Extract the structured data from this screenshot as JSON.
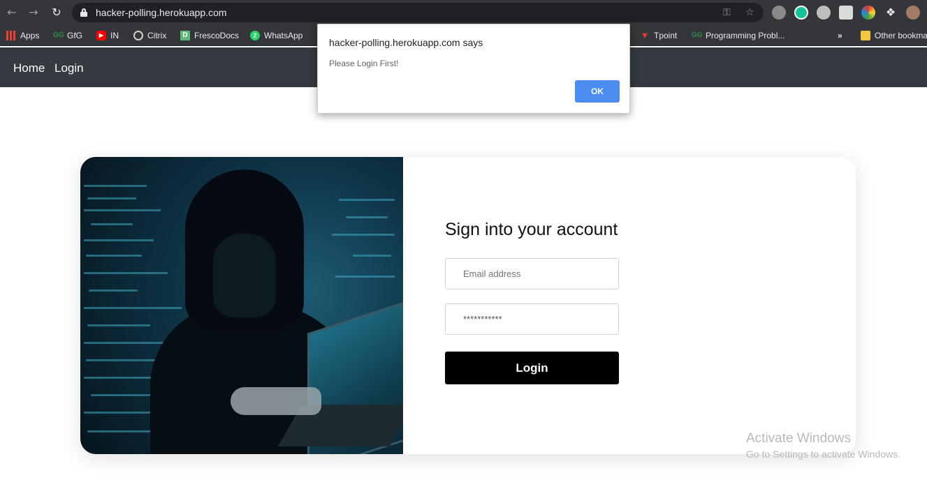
{
  "browser": {
    "url": "hacker-polling.herokuapp.com",
    "bookmarks": [
      {
        "label": "Apps",
        "icon": "apps-grid-icon"
      },
      {
        "label": "GfG",
        "icon": "gfg-icon"
      },
      {
        "label": "IN",
        "icon": "youtube-icon"
      },
      {
        "label": "Citrix",
        "icon": "citrix-icon"
      },
      {
        "label": "FrescoDocs",
        "icon": "frescodocs-icon"
      },
      {
        "label": "WhatsApp",
        "icon": "whatsapp-icon"
      },
      {
        "label": "Tpoint",
        "icon": "tpoint-icon"
      },
      {
        "label": "Programming Probl...",
        "icon": "gfg-icon"
      },
      {
        "label": "»",
        "icon": "more-bookmarks-icon"
      },
      {
        "label": "Other bookma",
        "icon": "folder-icon"
      }
    ]
  },
  "nav": {
    "home": "Home",
    "login": "Login"
  },
  "form": {
    "title": "Sign into your account",
    "email_placeholder": "Email address",
    "password_value": "***********",
    "submit": "Login"
  },
  "dialog": {
    "title": "hacker-polling.herokuapp.com says",
    "message": "Please Login First!",
    "ok": "OK"
  },
  "watermark": {
    "title": "Activate Windows",
    "subtitle": "Go to Settings to activate Windows."
  },
  "colors": {
    "navbar": "#343a40",
    "button": "#000000",
    "dialog_ok": "#4a8cf0"
  }
}
